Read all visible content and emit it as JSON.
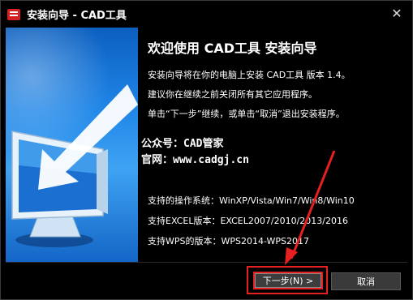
{
  "window": {
    "title": "安装向导 - CAD工具",
    "close_glyph": "✕"
  },
  "main": {
    "heading": "欢迎使用 CAD工具 安装向导",
    "lines": [
      "安装向导将在你的电脑上安装 CAD工具 版本 1.4。",
      "建议你在继续之前关闭所有其它应用程序。",
      "单击“下一步”继续，或单击“取消”退出安装程序。"
    ],
    "watermark_line1": "公众号：CAD管家",
    "watermark_line2": "官网：www.cadgj.cn",
    "support_os": "支持的操作系统：WinXP/Vista/Win7/Win8/Win10",
    "support_excel": "支持EXCEL版本：EXCEL2007/2010/2013/2016",
    "support_wps": "支持WPS的版本：WPS2014-WPS2017"
  },
  "buttons": {
    "next_label": "下一步(N) >",
    "cancel_label": "取消"
  },
  "colors": {
    "highlight": "#e62020",
    "panel_blue": "#1f86e8"
  },
  "icons": {
    "app": "app-logo-icon",
    "close": "close-icon",
    "monitor": "monitor-illustration",
    "annotation": "red-arrow-annotation"
  }
}
